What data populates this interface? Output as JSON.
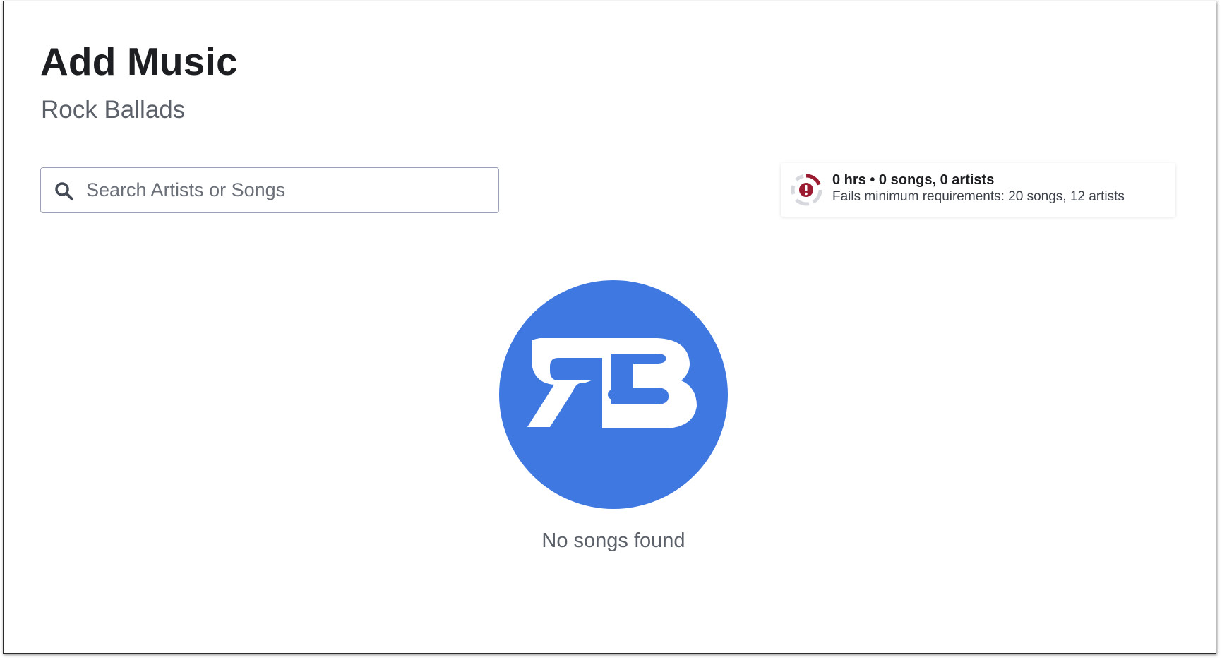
{
  "header": {
    "title": "Add Music",
    "playlist_name": "Rock Ballads"
  },
  "search": {
    "placeholder": "Search Artists or Songs",
    "value": "",
    "icon": "search-icon"
  },
  "status": {
    "icon": "alert-progress-icon",
    "summary": "0 hrs • 0 songs, 0 artists",
    "detail": "Fails minimum requirements: 20 songs, 12 artists",
    "progress": 0,
    "alert_color": "#9b1b30",
    "track_color": "#d6d8de"
  },
  "empty_state": {
    "logo": "rb-logo",
    "logo_color": "#3f78e0",
    "message": "No songs found"
  }
}
